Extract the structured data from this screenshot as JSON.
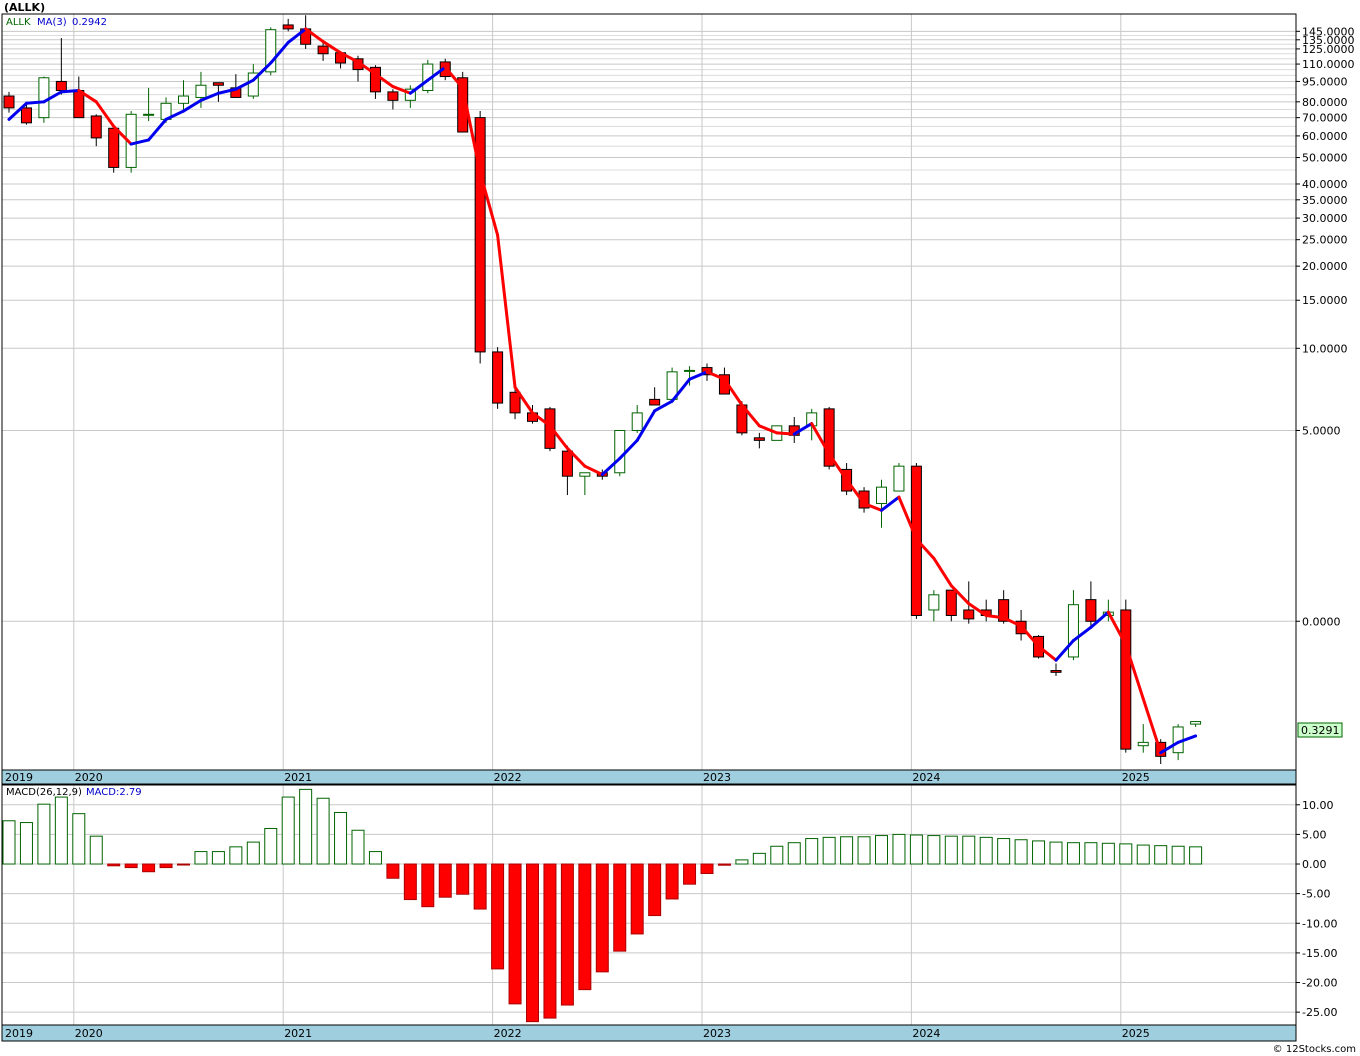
{
  "symbol_title": "(ALLK)",
  "legend": {
    "ticker": "ALLK",
    "ma_label": "MA(3)",
    "ma_value": "0.2942"
  },
  "last_price": "0.3291",
  "macd_legend": {
    "params": "MACD(26,12,9)",
    "value": "MACD:2.79"
  },
  "watermark": "© 12Stocks.com",
  "colors": {
    "up": "#006400",
    "down": "#ff0000",
    "ma_up": "#0000ee",
    "ma_down": "#ff0000",
    "axis_band": "#9fcfdf",
    "last_price_bg": "#ccffcc",
    "grid": "#c8c8c8"
  },
  "chart_data": [
    {
      "type": "candlestick",
      "title": "(ALLK)",
      "scale": "log",
      "grid": true,
      "y_ticks": [
        "145.0000",
        "135.0000",
        "125.0000",
        "110.0000",
        "95.0000",
        "80.0000",
        "70.0000",
        "60.0000",
        "50.0000",
        "40.0000",
        "35.0000",
        "30.0000",
        "25.0000",
        "20.0000",
        "15.0000",
        "10.0000",
        "5.0000",
        "0.0000"
      ],
      "x_year_labels": [
        "2019",
        "2020",
        "2021",
        "2022",
        "2023",
        "2024",
        "2025"
      ],
      "series": [
        {
          "name": "ALLK",
          "ohlc": [
            [
              84,
              87,
              73,
              76
            ],
            [
              76,
              80,
              66,
              67
            ],
            [
              70,
              99,
              67,
              98
            ],
            [
              95,
              137,
              85,
              88
            ],
            [
              88,
              99,
              70,
              70
            ],
            [
              71,
              72,
              55,
              59
            ],
            [
              64,
              65,
              44,
              46
            ],
            [
              46,
              74,
              44,
              72
            ],
            [
              72,
              90,
              68,
              72
            ],
            [
              69,
              83,
              67,
              79
            ],
            [
              79,
              96,
              73,
              84
            ],
            [
              83,
              103,
              76,
              92
            ],
            [
              94,
              94,
              80,
              92
            ],
            [
              90,
              101,
              83,
              83
            ],
            [
              84,
              110,
              82,
              102
            ],
            [
              103,
              150,
              100,
              147
            ],
            [
              153,
              161,
              145,
              148
            ],
            [
              148,
              166,
              125,
              130
            ],
            [
              128,
              132,
              113,
              120
            ],
            [
              121,
              122,
              106,
              111
            ],
            [
              115,
              118,
              95,
              105
            ],
            [
              107,
              109,
              82,
              87
            ],
            [
              87,
              89,
              75,
              81
            ],
            [
              81,
              92,
              76,
              89
            ],
            [
              88,
              114,
              86,
              110
            ],
            [
              112,
              115,
              96,
              99
            ],
            [
              98,
              103,
              62,
              62
            ],
            [
              70,
              74,
              8.8,
              9.7
            ],
            [
              9.7,
              10.1,
              6.0,
              6.3
            ],
            [
              6.9,
              7.2,
              5.5,
              5.8
            ],
            [
              5.8,
              6.2,
              5.3,
              5.4
            ],
            [
              6.0,
              6.1,
              4.2,
              4.3
            ],
            [
              4.2,
              4.4,
              2.9,
              3.4
            ],
            [
              3.4,
              3.5,
              2.9,
              3.5
            ],
            [
              3.5,
              3.6,
              3.3,
              3.4
            ],
            [
              3.5,
              5.0,
              3.4,
              5.0
            ],
            [
              5.0,
              6.2,
              4.9,
              5.8
            ],
            [
              6.5,
              7.2,
              6.2,
              6.2
            ],
            [
              6.5,
              8.5,
              6.3,
              8.2
            ],
            [
              8.3,
              8.6,
              7.3,
              8.3
            ],
            [
              8.5,
              8.8,
              7.6,
              8.0
            ],
            [
              8.0,
              8.5,
              6.8,
              6.8
            ],
            [
              6.2,
              6.4,
              4.8,
              4.9
            ],
            [
              4.7,
              4.9,
              4.3,
              4.6
            ],
            [
              4.6,
              5.2,
              4.6,
              5.2
            ],
            [
              5.2,
              5.6,
              4.5,
              4.8
            ],
            [
              5.2,
              6.0,
              4.6,
              5.8
            ],
            [
              6.0,
              6.1,
              3.6,
              3.7
            ],
            [
              3.6,
              3.8,
              2.9,
              3.0
            ],
            [
              3.0,
              3.1,
              2.5,
              2.6
            ],
            [
              2.7,
              3.3,
              2.2,
              3.1
            ],
            [
              3.0,
              3.8,
              3.0,
              3.7
            ],
            [
              3.7,
              3.8,
              1.02,
              1.05
            ],
            [
              1.1,
              1.3,
              1.0,
              1.25
            ],
            [
              1.3,
              1.3,
              1.0,
              1.05
            ],
            [
              1.1,
              1.4,
              0.98,
              1.02
            ],
            [
              1.1,
              1.2,
              1.0,
              1.05
            ],
            [
              1.2,
              1.3,
              0.98,
              1.0
            ],
            [
              1.0,
              1.1,
              0.85,
              0.9
            ],
            [
              0.88,
              0.89,
              0.73,
              0.74
            ],
            [
              0.66,
              0.7,
              0.63,
              0.65
            ],
            [
              0.74,
              1.3,
              0.72,
              1.15
            ],
            [
              1.2,
              1.4,
              0.95,
              1.0
            ],
            [
              1.05,
              1.2,
              1.0,
              1.08
            ],
            [
              1.1,
              1.2,
              0.33,
              0.34
            ],
            [
              0.35,
              0.42,
              0.33,
              0.36
            ],
            [
              0.36,
              0.37,
              0.3,
              0.32
            ],
            [
              0.33,
              0.42,
              0.31,
              0.41
            ],
            [
              0.42,
              0.43,
              0.41,
              0.4291
            ]
          ]
        },
        {
          "name": "MA(3)",
          "values": [
            69,
            79,
            80,
            87,
            88,
            80,
            65,
            56,
            58,
            69,
            74,
            81,
            86,
            89,
            96,
            111,
            132,
            148,
            133,
            121,
            112,
            101,
            91,
            86,
            96,
            107,
            90,
            44,
            26,
            7.2,
            5.8,
            5.2,
            4.3,
            3.7,
            3.45,
            3.95,
            4.6,
            5.9,
            6.4,
            7.7,
            8.2,
            7.7,
            6.2,
            5.2,
            4.9,
            4.85,
            5.3,
            4.1,
            3.3,
            2.7,
            2.55,
            2.85,
            2.0,
            1.7,
            1.35,
            1.16,
            1.05,
            1.03,
            0.96,
            0.81,
            0.72,
            0.85,
            0.95,
            1.08,
            0.82,
            0.52,
            0.33,
            0.36,
            0.38
          ]
        }
      ]
    },
    {
      "type": "bar",
      "title": "MACD(26,12,9)",
      "y_ticks": [
        "10.00",
        "5.00",
        "0.00",
        "-5.00",
        "-10.00",
        "-15.00",
        "-20.00",
        "-25.00"
      ],
      "ylim": [
        -27,
        13
      ],
      "x_year_labels": [
        "2019",
        "2020",
        "2021",
        "2022",
        "2023",
        "2024",
        "2025"
      ],
      "values": [
        7.3,
        7.0,
        10.1,
        11.3,
        8.5,
        4.7,
        -0.3,
        -0.6,
        -1.3,
        -0.6,
        -0.1,
        2.1,
        2.1,
        2.9,
        3.7,
        6.0,
        11.3,
        12.6,
        11.1,
        8.7,
        5.7,
        2.1,
        -2.4,
        -6.0,
        -7.2,
        -5.6,
        -5.1,
        -7.6,
        -17.7,
        -23.6,
        -26.6,
        -26.0,
        -23.8,
        -21.2,
        -18.2,
        -14.7,
        -11.8,
        -8.7,
        -5.9,
        -3.4,
        -1.6,
        -0.2,
        0.7,
        1.8,
        3.0,
        3.6,
        4.3,
        4.5,
        4.6,
        4.6,
        4.8,
        5.0,
        4.9,
        4.8,
        4.7,
        4.7,
        4.5,
        4.3,
        4.1,
        3.9,
        3.7,
        3.6,
        3.6,
        3.5,
        3.4,
        3.2,
        3.1,
        3.0,
        2.9
      ]
    }
  ]
}
